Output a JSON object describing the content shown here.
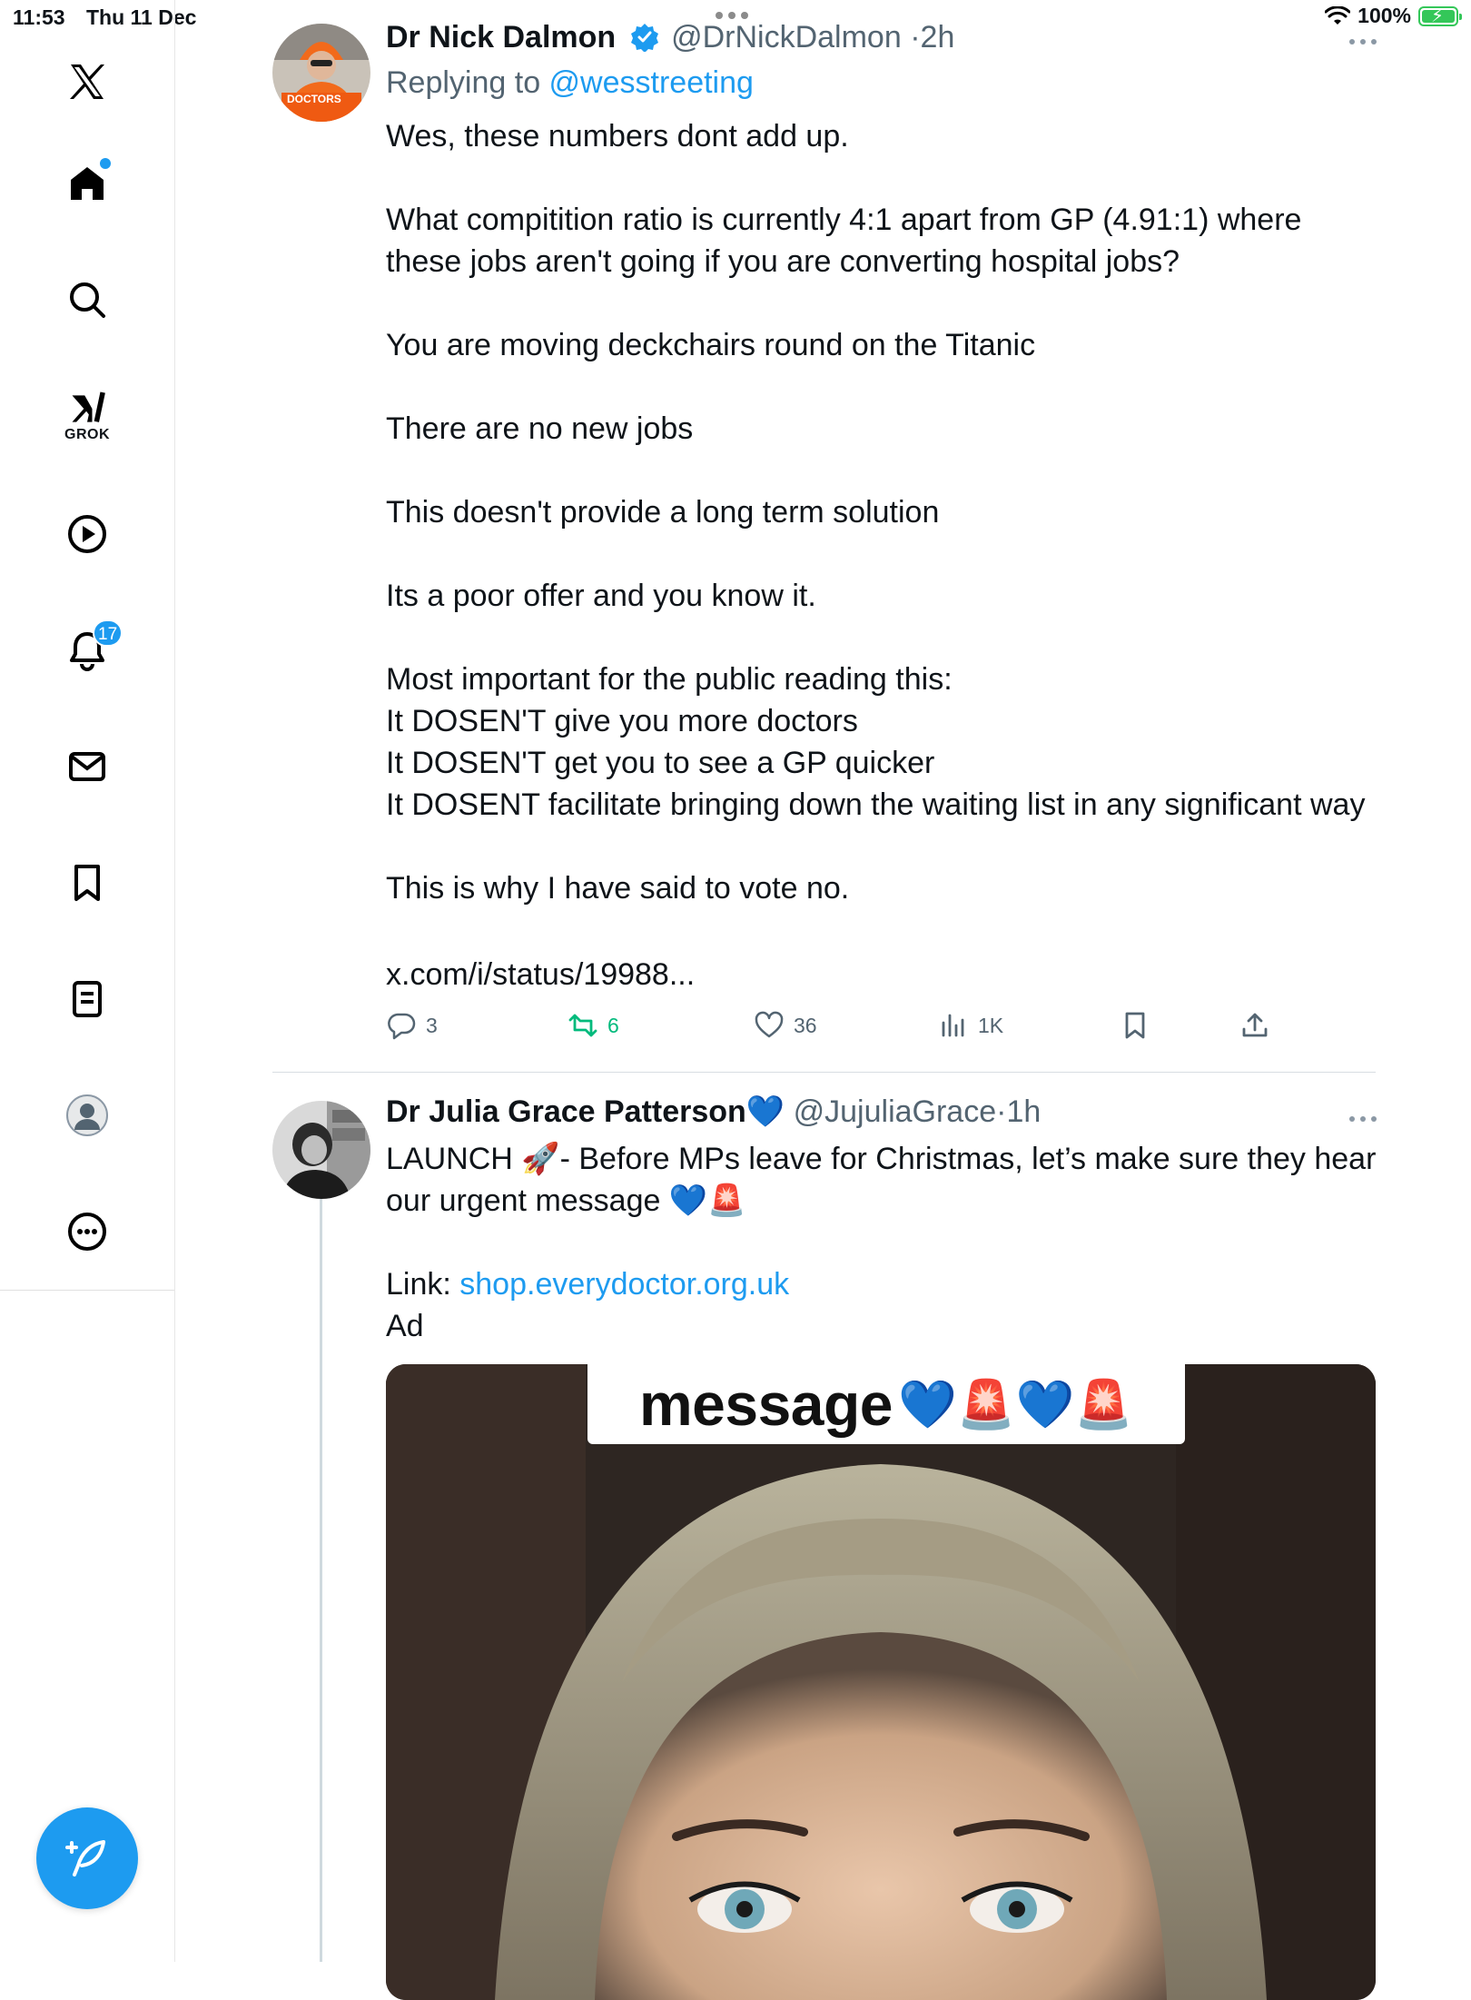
{
  "status_bar": {
    "time": "11:53",
    "date": "Thu 11 Dec",
    "battery": "100%"
  },
  "sidebar": {
    "grok_label": "GROK",
    "notifications_count": "17",
    "icons": [
      "x-logo-icon",
      "home-icon",
      "search-icon",
      "grok-icon",
      "video-icon",
      "bell-icon",
      "mail-icon",
      "bookmark-icon",
      "lists-icon",
      "profile-icon",
      "more-circle-icon",
      "compose-icon"
    ]
  },
  "tweet1": {
    "name": "Dr Nick Dalmon",
    "handle": "@DrNickDalmon",
    "time": "2h",
    "replying_prefix": "Replying to ",
    "replying_to": "@wesstreeting",
    "avatar_sign": "DOCTORS",
    "lines": [
      "Wes, these numbers dont add up.",
      "",
      "What compitition ratio is currently 4:1 apart from GP (4.91:1) where",
      "these jobs aren't going if you are converting hospital jobs?",
      "",
      "You are moving deckchairs round on the Titanic",
      "",
      "There are no new jobs",
      "",
      "This doesn't provide a long term solution",
      "",
      "Its a poor offer and you know it.",
      "",
      "Most important for the public reading this:",
      "It DOSEN'T give you more doctors",
      "It DOSEN'T get you to see a GP quicker",
      "It DOSENT facilitate bringing down the waiting list in any significant way",
      "",
      "This is why I have said to vote no."
    ],
    "link": "x.com/i/status/19988...",
    "replies": "3",
    "reposts": "6",
    "likes": "36",
    "views": "1K"
  },
  "tweet2": {
    "name": "Dr Julia Grace Patterson",
    "name_emoji": "💙",
    "handle": "@JujuliaGrace",
    "time": "1h",
    "line1": "LAUNCH 🚀- Before MPs leave for Christmas, let’s make sure they hear",
    "line2": "our urgent message 💙🚨",
    "link_label": "Link: ",
    "link": "shop.everydoctor.org.uk",
    "ad": "Ad",
    "media_caption": "message",
    "media_caption_emojis": "💙🚨💙🚨"
  },
  "colors": {
    "accent": "#1d9bf0",
    "repost_green": "#00ba7c",
    "text": "#0f1419",
    "secondary": "#536471"
  }
}
